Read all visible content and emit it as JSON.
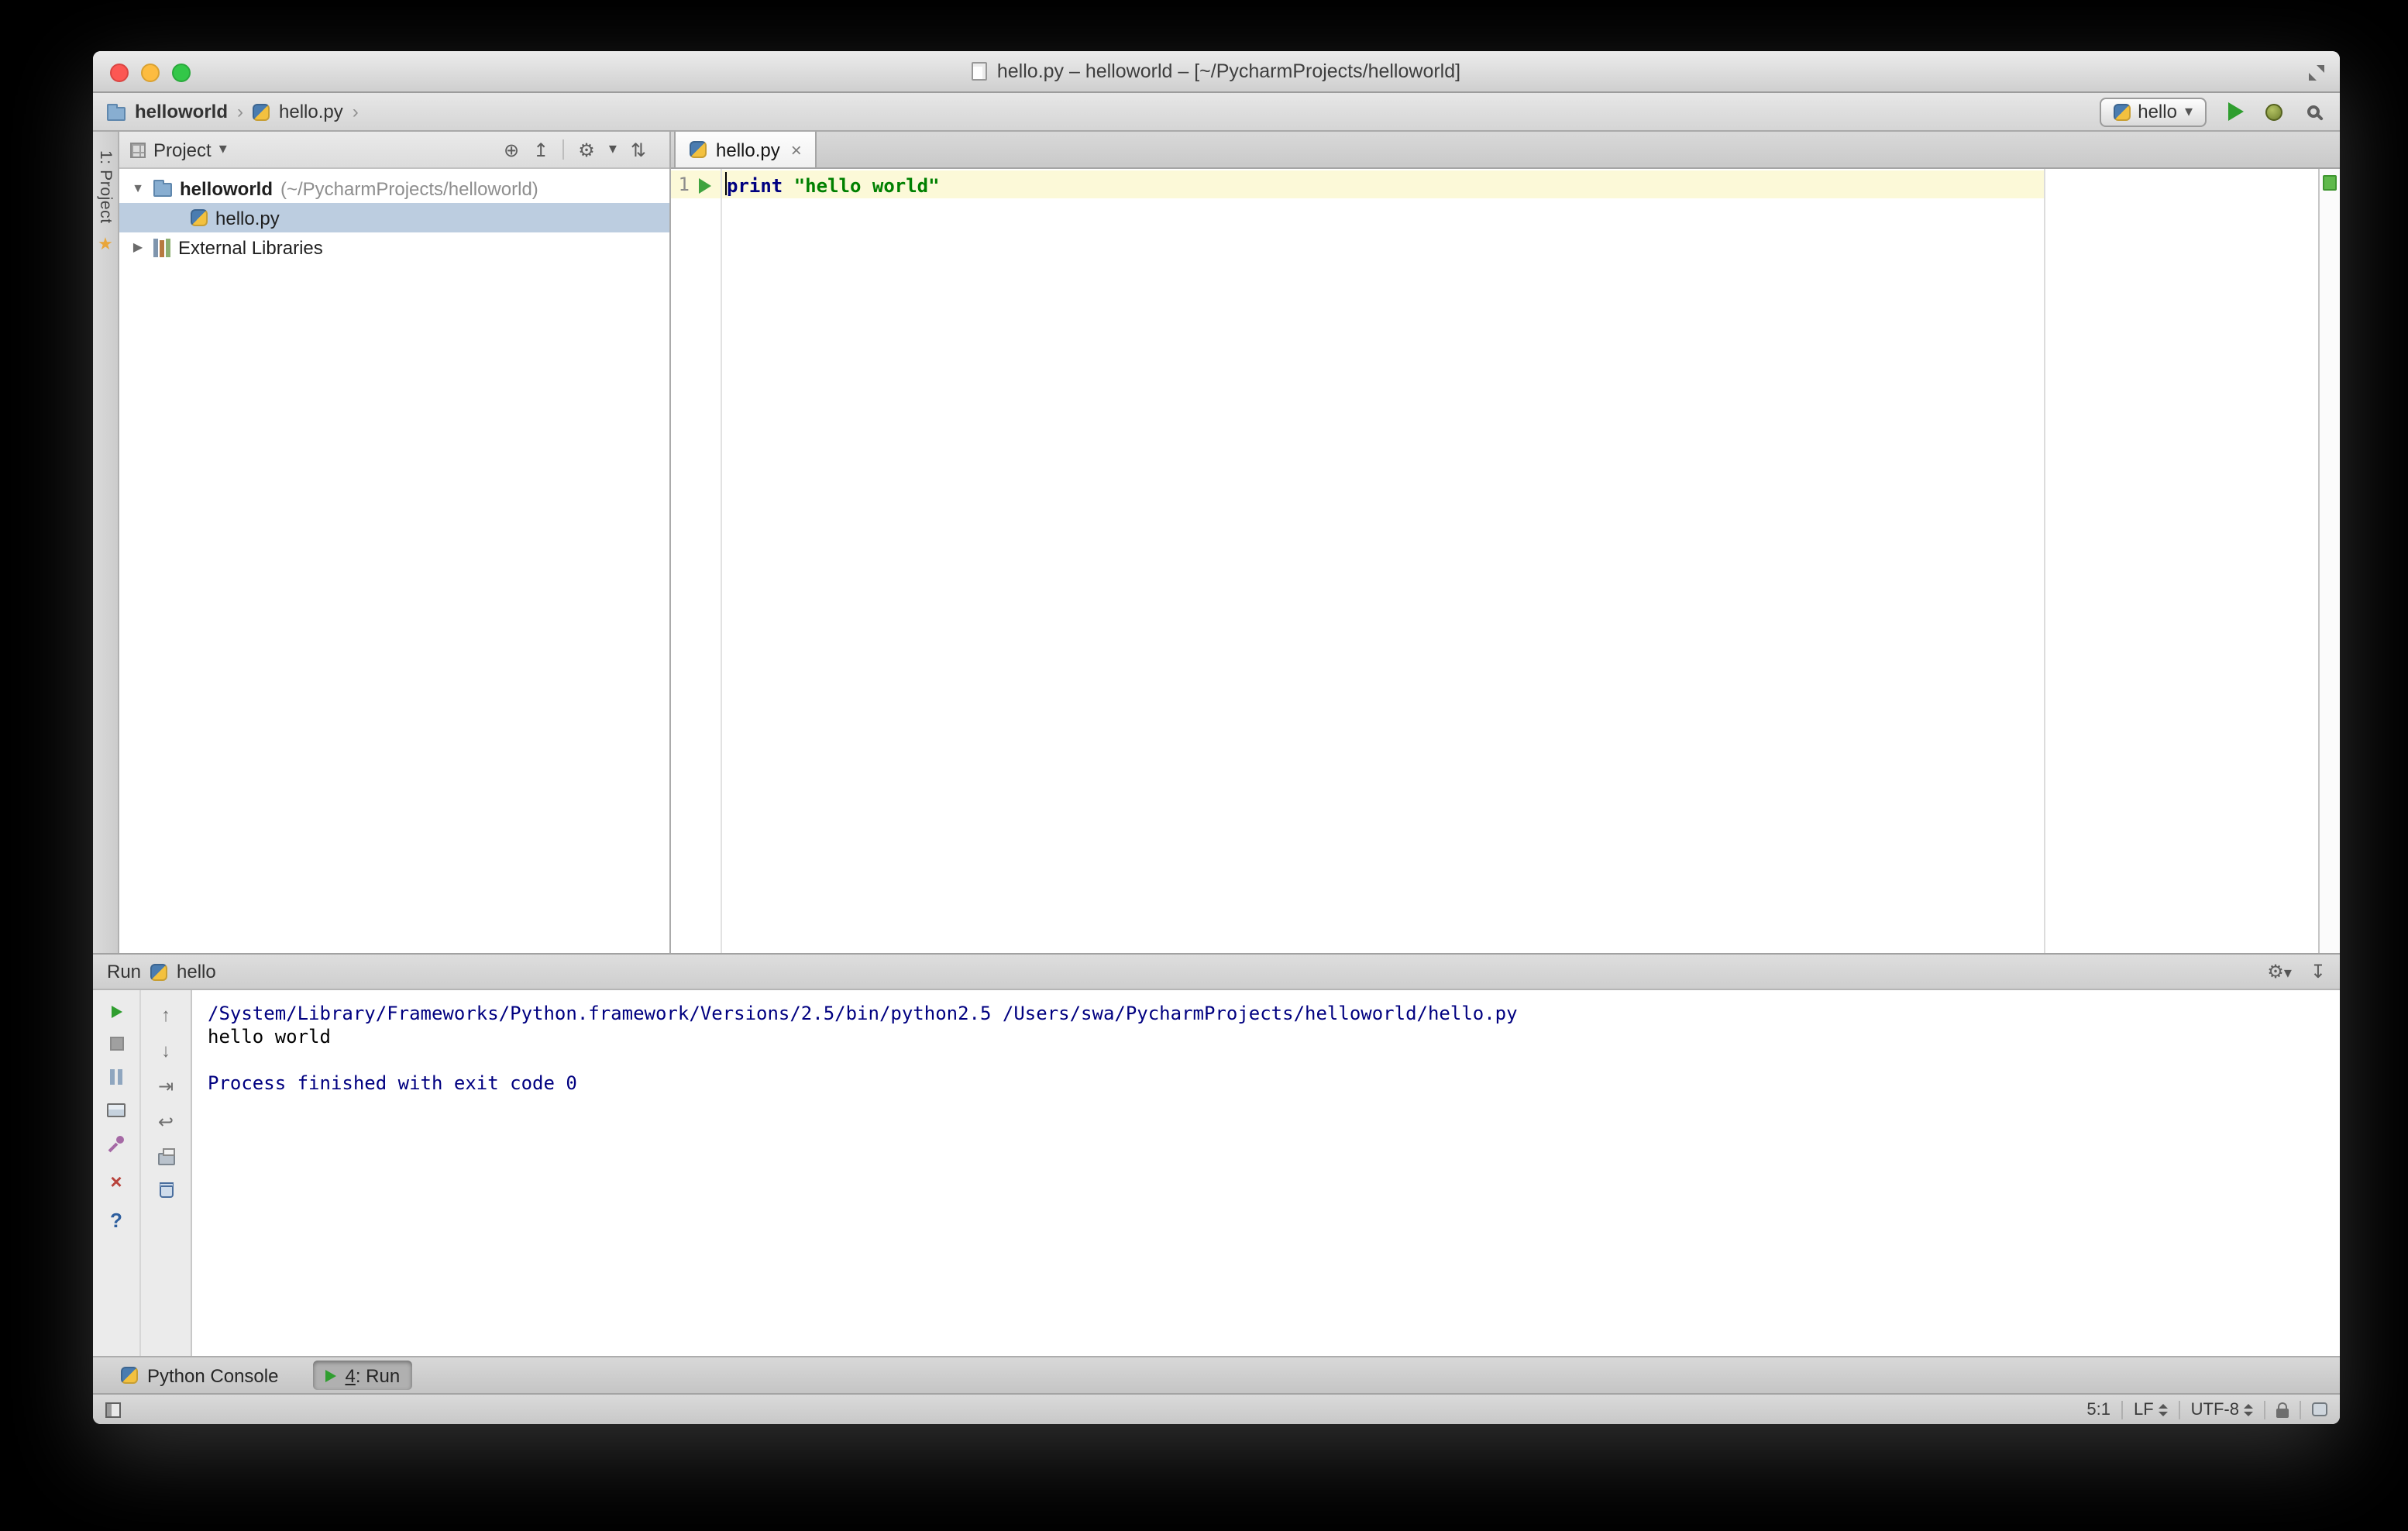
{
  "colors": {
    "run_green": "#2f9e2f",
    "keyword_blue": "#000080",
    "string_green": "#008000",
    "console_system_blue": "#000080",
    "caret_line_yellow": "#fcf9d8",
    "tree_selection": "#bccde0",
    "inspection_ok_green": "#5fb94b"
  },
  "titlebar": {
    "title": "hello.py – helloworld – [~/PycharmProjects/helloworld]"
  },
  "navbar": {
    "breadcrumb": [
      {
        "label": "helloworld"
      },
      {
        "label": "hello.py"
      }
    ],
    "run_config": {
      "label": "hello"
    }
  },
  "tool_strip": {
    "project_button": "1: Project"
  },
  "project_panel": {
    "title": "Project",
    "tree": [
      {
        "label": "helloworld",
        "suffix": "(~/PycharmProjects/helloworld)"
      },
      {
        "label": "hello.py"
      },
      {
        "label": "External Libraries"
      }
    ]
  },
  "editor": {
    "tab": {
      "label": "hello.py"
    },
    "line_number": "1",
    "code": {
      "keyword": "print ",
      "string": "\"hello world\""
    }
  },
  "run_panel": {
    "title": "Run",
    "config": "hello",
    "console": [
      "/System/Library/Frameworks/Python.framework/Versions/2.5/bin/python2.5 /Users/swa/PycharmProjects/helloworld/hello.py",
      "hello world",
      "",
      "Process finished with exit code 0"
    ]
  },
  "toolwindow_bar": {
    "python_console": "Python Console",
    "run_tab": {
      "mnemonic": "4",
      "rest": ": Run"
    }
  },
  "statusbar": {
    "caret_position": "5:1",
    "line_separator": "LF",
    "encoding": "UTF-8"
  },
  "icons": {
    "gear": "⚙",
    "dropdown_arrow": "▾",
    "breadcrumb_chevron": "›",
    "tree_expanded": "▼",
    "tree_collapsed": "▶",
    "locate": "⊕",
    "collapse_all": "↥",
    "sort": "⇅",
    "hide": "↧",
    "close": "×",
    "help": "?",
    "up_arrow": "↑",
    "down_arrow": "↓",
    "scroll_to_end": "⇥",
    "soft_wrap": "↩",
    "tab_close": "×"
  }
}
